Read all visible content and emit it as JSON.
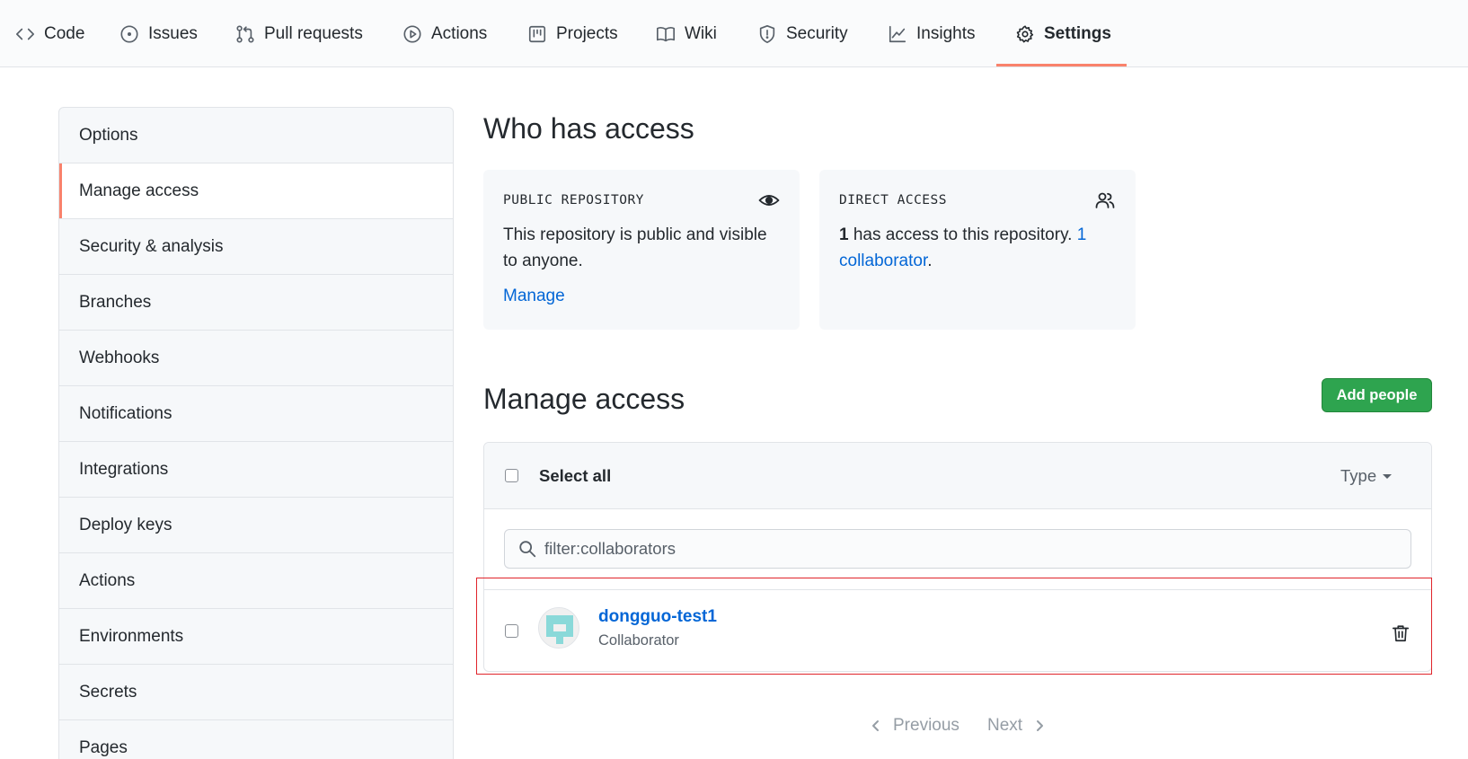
{
  "nav": {
    "tabs": [
      {
        "label": "Code",
        "icon": "code-icon"
      },
      {
        "label": "Issues",
        "icon": "issue-icon"
      },
      {
        "label": "Pull requests",
        "icon": "pull-request-icon"
      },
      {
        "label": "Actions",
        "icon": "play-icon"
      },
      {
        "label": "Projects",
        "icon": "project-icon"
      },
      {
        "label": "Wiki",
        "icon": "book-icon"
      },
      {
        "label": "Security",
        "icon": "shield-icon"
      },
      {
        "label": "Insights",
        "icon": "graph-icon"
      },
      {
        "label": "Settings",
        "icon": "gear-icon"
      }
    ],
    "selected": "Settings",
    "accent_color": "#f9826c"
  },
  "sidebar": {
    "items": [
      {
        "label": "Options"
      },
      {
        "label": "Manage access"
      },
      {
        "label": "Security & analysis"
      },
      {
        "label": "Branches"
      },
      {
        "label": "Webhooks"
      },
      {
        "label": "Notifications"
      },
      {
        "label": "Integrations"
      },
      {
        "label": "Deploy keys"
      },
      {
        "label": "Actions"
      },
      {
        "label": "Environments"
      },
      {
        "label": "Secrets"
      },
      {
        "label": "Pages"
      }
    ],
    "selected": "Manage access"
  },
  "who_has_access": {
    "title": "Who has access",
    "public_card": {
      "label": "PUBLIC REPOSITORY",
      "icon": "eye-icon",
      "text": "This repository is public and visible to anyone.",
      "link": "Manage"
    },
    "direct_card": {
      "label": "DIRECT ACCESS",
      "icon": "people-icon",
      "count": "1",
      "text": " has access to this repository. ",
      "link": "1 collaborator",
      "suffix": "."
    }
  },
  "manage_access": {
    "title": "Manage access",
    "add_button": "Add people",
    "add_button_color": "#2ea44f",
    "select_all": "Select all",
    "type_filter": "Type",
    "search_value": "filter:collaborators",
    "members": [
      {
        "name": "dongguo-test1",
        "role": "Collaborator"
      }
    ],
    "link_color": "#0366d6"
  },
  "pagination": {
    "previous": "Previous",
    "next": "Next"
  },
  "highlight_color": "#e0242b"
}
